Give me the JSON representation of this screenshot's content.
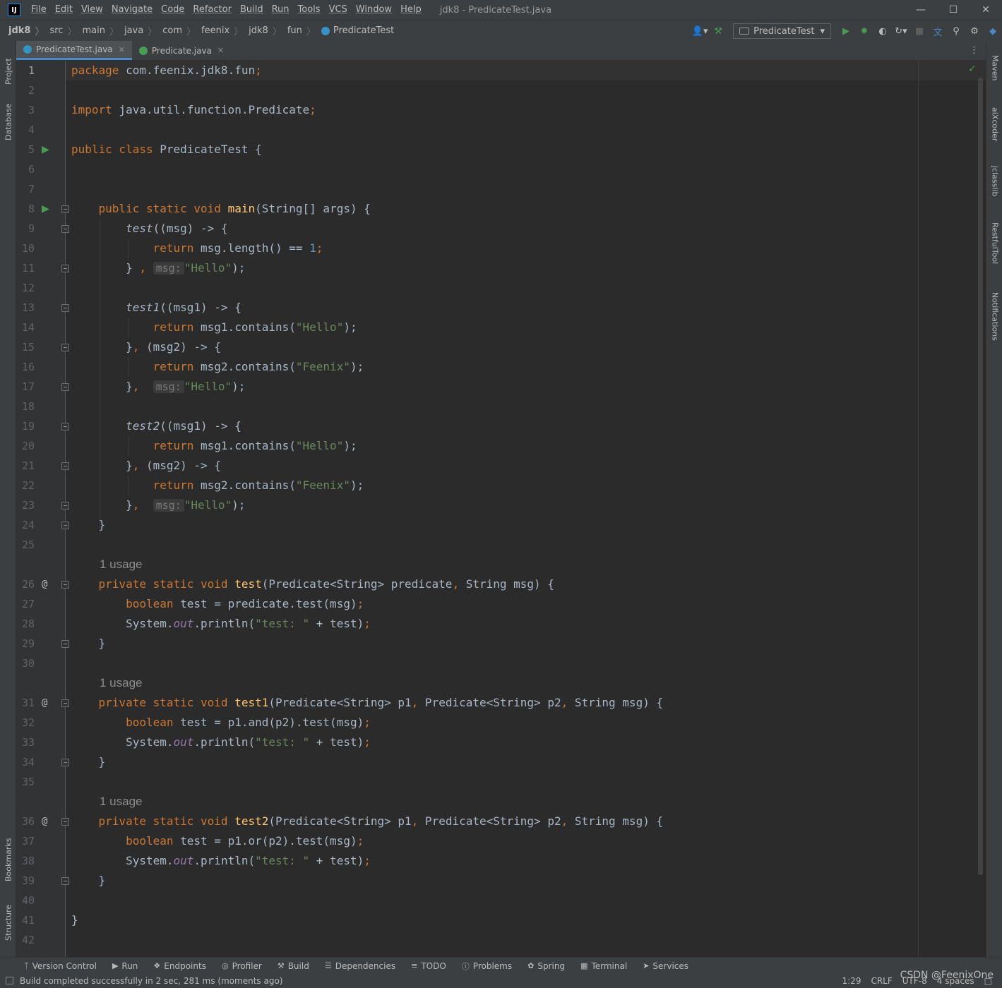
{
  "titlebar": {
    "menu": [
      "File",
      "Edit",
      "View",
      "Navigate",
      "Code",
      "Refactor",
      "Build",
      "Run",
      "Tools",
      "VCS",
      "Window",
      "Help"
    ],
    "title": "jdk8 - PredicateTest.java"
  },
  "breadcrumbs": [
    "jdk8",
    "src",
    "main",
    "java",
    "com",
    "feenix",
    "jdk8",
    "fun"
  ],
  "current_class": "PredicateTest",
  "run_config": "PredicateTest",
  "left_tools": [
    "Project",
    "Database",
    "Bookmarks",
    "Structure"
  ],
  "right_tools": [
    "Maven",
    "aiXcoder",
    "jclasslib",
    "RestfulTool",
    "Notifications"
  ],
  "tabs": [
    {
      "label": "PredicateTest.java",
      "active": true,
      "color": "#3592c4"
    },
    {
      "label": "Predicate.java",
      "active": false,
      "color": "#499c54"
    }
  ],
  "line_numbers": [
    "1",
    "2",
    "3",
    "4",
    "5",
    "6",
    "7",
    "8",
    "9",
    "10",
    "11",
    "12",
    "13",
    "14",
    "15",
    "16",
    "17",
    "18",
    "19",
    "20",
    "21",
    "22",
    "23",
    "24",
    "25",
    "26",
    "27",
    "28",
    "29",
    "30",
    "31",
    "32",
    "33",
    "34",
    "35",
    "36",
    "37",
    "38",
    "39",
    "40",
    "41",
    "42"
  ],
  "usage_hint": "1 usage",
  "param_hint": "msg:",
  "code": {
    "l1": [
      "package",
      " com.feenix.jdk8.fun",
      ";"
    ],
    "l3": [
      "import",
      " java.util.function.Predicate",
      ";"
    ],
    "l5": [
      "public class",
      " PredicateTest {"
    ],
    "l8": [
      "public static void ",
      "main",
      "(String[] args) {"
    ],
    "l9": [
      "test",
      "((msg) -> {"
    ],
    "l10": [
      "return",
      " msg.length() == ",
      "1",
      ";"
    ],
    "l11": [
      "}",
      " ,",
      "\"Hello\"",
      ");"
    ],
    "l13": [
      "test1",
      "((msg1) -> {"
    ],
    "l14": [
      "return",
      " msg1.contains(",
      "\"Hello\"",
      ");"
    ],
    "l15": [
      "}",
      ",",
      "(msg2) -> {"
    ],
    "l16": [
      "return",
      " msg2.contains(",
      "\"Feenix\"",
      ");"
    ],
    "l17": [
      "}",
      ",",
      "\"Hello\"",
      ");"
    ],
    "l19": [
      "test2",
      "((msg1) -> {"
    ],
    "l20": [
      "return",
      " msg1.contains(",
      "\"Hello\"",
      ");"
    ],
    "l21": [
      "}",
      ",",
      "(msg2) -> {"
    ],
    "l22": [
      "return",
      " msg2.contains(",
      "\"Feenix\"",
      ");"
    ],
    "l23": [
      "}",
      ",",
      "\"Hello\"",
      ");"
    ],
    "l24": [
      "}"
    ],
    "l26": [
      "private static void ",
      "test",
      "(Predicate<String> predicate",
      ",",
      " String msg) {"
    ],
    "l27": [
      "boolean",
      " test = predicate.test(msg)",
      ";"
    ],
    "l28": [
      "System.",
      "out",
      ".println(",
      "\"test: \"",
      " + test)",
      ";"
    ],
    "l29": [
      "}"
    ],
    "l31": [
      "private static void ",
      "test1",
      "(Predicate<String> p1",
      ",",
      " Predicate<String> p2",
      ",",
      " String msg) {"
    ],
    "l32": [
      "boolean",
      " test = p1.and(p2).test(msg)",
      ";"
    ],
    "l33": [
      "System.",
      "out",
      ".println(",
      "\"test: \"",
      " + test)",
      ";"
    ],
    "l34": [
      "}"
    ],
    "l36": [
      "private static void ",
      "test2",
      "(Predicate<String> p1",
      ",",
      " Predicate<String> p2",
      ",",
      " String msg) {"
    ],
    "l37": [
      "boolean",
      " test = p1.or(p2).test(msg)",
      ";"
    ],
    "l38": [
      "System.",
      "out",
      ".println(",
      "\"test: \"",
      " + test)",
      ";"
    ],
    "l39": [
      "}"
    ],
    "l41": [
      "}"
    ]
  },
  "tool_windows": [
    "Version Control",
    "Run",
    "Endpoints",
    "Profiler",
    "Build",
    "Dependencies",
    "TODO",
    "Problems",
    "Spring",
    "Terminal",
    "Services"
  ],
  "status": {
    "message": "Build completed successfully in 2 sec, 281 ms (moments ago)",
    "position": "1:29",
    "line_sep": "CRLF",
    "encoding": "UTF-8",
    "indent": "4 spaces"
  },
  "watermark": "CSDN @FeenixOne",
  "colors": {
    "keyword": "#cc7832",
    "string": "#6a8759",
    "number": "#6897bb",
    "method_decl": "#ffc66d",
    "static_field": "#9876aa",
    "text": "#a9b7c6",
    "run": "#499c54"
  }
}
